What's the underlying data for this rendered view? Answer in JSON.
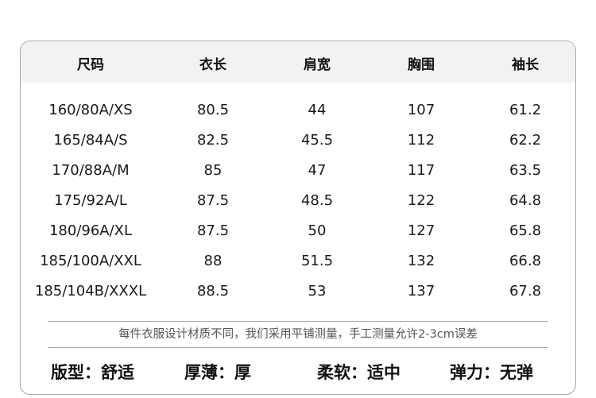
{
  "table": {
    "columns": [
      "尺码",
      "衣长",
      "肩宽",
      "胸围",
      "袖长"
    ],
    "rows": [
      [
        "160/80A/XS",
        "80.5",
        "44",
        "107",
        "61.2"
      ],
      [
        "165/84A/S",
        "82.5",
        "45.5",
        "112",
        "62.2"
      ],
      [
        "170/88A/M",
        "85",
        "47",
        "117",
        "63.5"
      ],
      [
        "175/92A/L",
        "87.5",
        "48.5",
        "122",
        "64.8"
      ],
      [
        "180/96A/XL",
        "87.5",
        "50",
        "127",
        "65.8"
      ],
      [
        "185/100A/XXL",
        "88",
        "51.5",
        "132",
        "66.8"
      ],
      [
        "185/104B/XXXL",
        "88.5",
        "53",
        "137",
        "67.8"
      ]
    ]
  },
  "note": "每件衣服设计材质不同，我们采用平铺测量，手工测量允许2-3cm误差",
  "attributes": [
    "版型：舒适",
    "厚薄：厚",
    "柔软：适中",
    "弹力：无弹"
  ],
  "colors": {
    "header_bg": "#f2f2f2",
    "border": "#a9a9a9",
    "note_text": "#555555"
  }
}
